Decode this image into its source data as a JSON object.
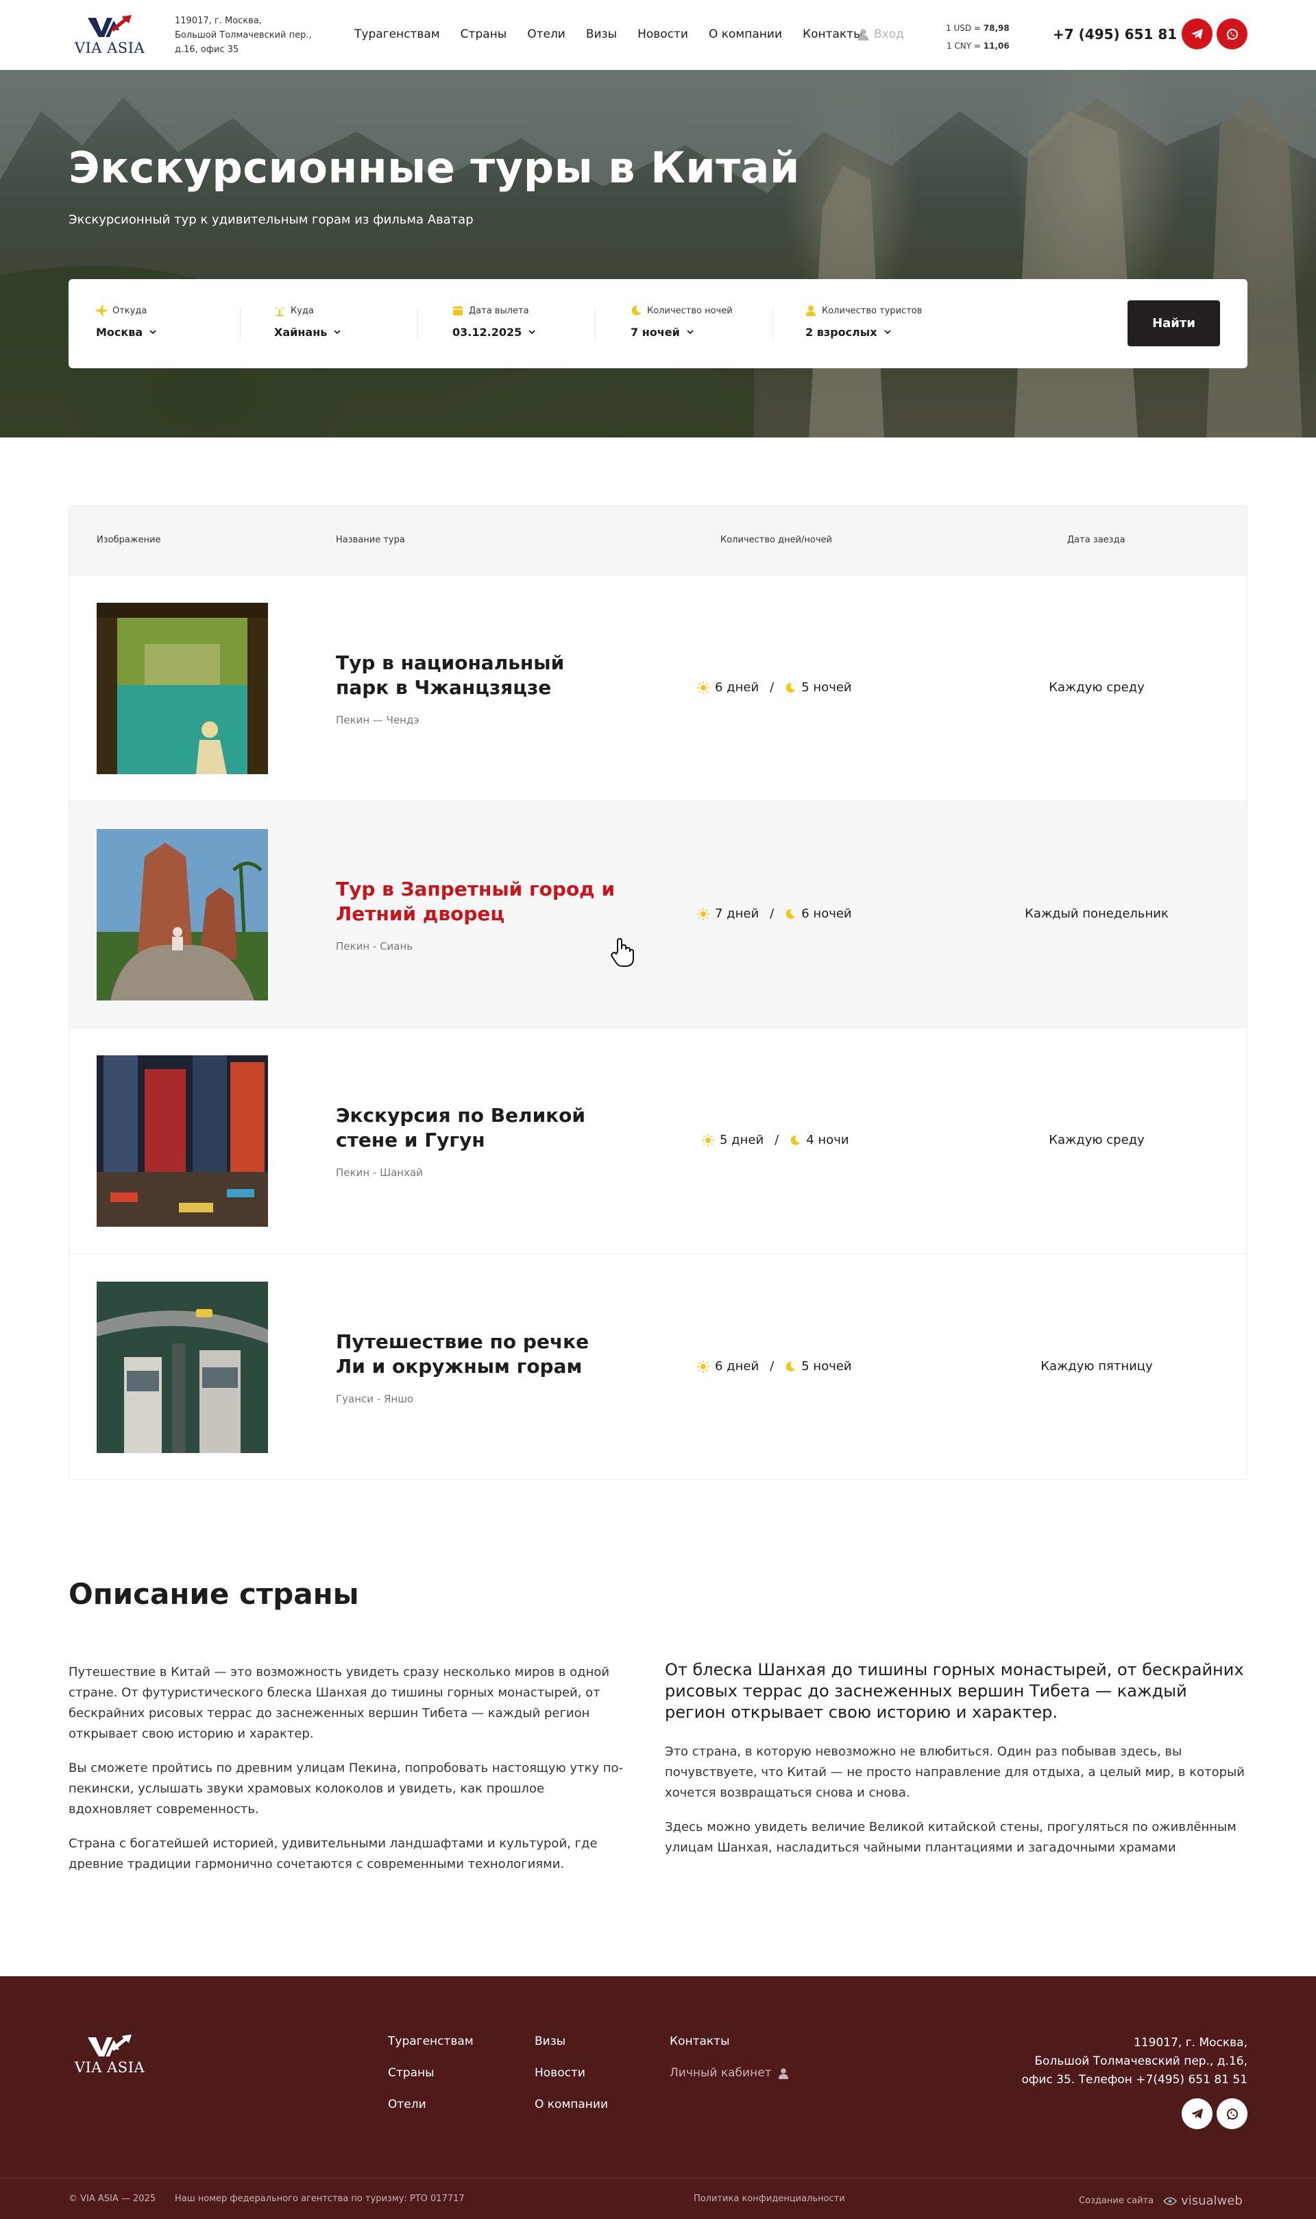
{
  "header": {
    "logo_text": "VIA ASIA",
    "address_lines": [
      "119017, г. Москва,",
      "Большой Толмачевский пер.,",
      "д.16, офис 35"
    ],
    "nav": [
      "Турагенствам",
      "Страны",
      "Отели",
      "Визы",
      "Новости",
      "О компании",
      "Контакты"
    ],
    "login_label": "Вход",
    "rates": [
      {
        "label": "1 USD =",
        "value": "78,98"
      },
      {
        "label": "1 CNY =",
        "value": "11,06"
      }
    ],
    "phone": "+7 (495) 651 81 51"
  },
  "hero": {
    "title": "Экскурсионные туры в Китай",
    "subtitle": "Экскурсионный тур к удивительным горам из фильма Аватар"
  },
  "search": {
    "fields": [
      {
        "label": "Откуда",
        "value": "Москва",
        "icon": "plane-icon"
      },
      {
        "label": "Куда",
        "value": "Хайнань",
        "icon": "palm-icon"
      },
      {
        "label": "Дата вылета",
        "value": "03.12.2025",
        "icon": "calendar-icon"
      },
      {
        "label": "Количество ночей",
        "value": "7 ночей",
        "icon": "moon-icon"
      },
      {
        "label": "Количество туристов",
        "value": "2 взрослых",
        "icon": "person-icon"
      }
    ],
    "button_label": "Найти"
  },
  "table": {
    "headers": [
      "Изображение",
      "Название тура",
      "Количество дней/ночей",
      "Дата заезда"
    ],
    "rows": [
      {
        "title": "Тур в национальный парк в Чжанцзяцзе",
        "route": "Пекин — Чендэ",
        "days": "6 дней",
        "nights": "5 ночей",
        "date": "Каждую среду",
        "highlight": false
      },
      {
        "title": "Тур в Запретный город и Летний дворец",
        "route": "Пекин - Сиань",
        "days": "7 дней",
        "nights": "6 ночей",
        "date": "Каждый понедельник",
        "highlight": true
      },
      {
        "title": "Экскурсия по Великой стене и Гугун",
        "route": "Пекин - Шанхай",
        "days": "5 дней",
        "nights": "4 ночи",
        "date": "Каждую среду",
        "highlight": false
      },
      {
        "title": "Путешествие по речке Ли и окружным горам",
        "route": "Гуанси - Яншо",
        "days": "6 дней",
        "nights": "5 ночей",
        "date": "Каждую пятницу",
        "highlight": false
      }
    ]
  },
  "description": {
    "heading": "Описание страны",
    "left": [
      "Путешествие в Китай — это возможность увидеть сразу несколько миров в одной стране. От футуристического блеска Шанхая до тишины горных монастырей, от бескрайних рисовых террас до заснеженных вершин Тибета — каждый регион открывает свою историю и характер.",
      "Вы сможете пройтись по древним улицам Пекина, попробовать настоящую утку по-пекински, услышать звуки храмовых колоколов и увидеть, как прошлое вдохновляет современность.",
      "Страна с богатейшей историей, удивительными ландшафтами и культурой, где древние традиции гармонично сочетаются с современными технологиями."
    ],
    "right_heading": "От блеска Шанхая до тишины горных монастырей, от бескрайних рисовых террас до заснеженных вершин Тибета — каждый регион открывает свою историю и характер.",
    "right": [
      "Это страна, в которую невозможно не влюбиться. Один раз побывав здесь, вы почувствуете, что Китай — не просто направление для отдыха, а целый мир, в который хочется возвращаться снова и снова.",
      "Здесь можно увидеть величие Великой китайской стены, прогуляться по оживлённым улицам Шанхая, насладиться чайными плантациями и загадочными храмами"
    ]
  },
  "footer": {
    "logo_text": "VIA ASIA",
    "col1": [
      "Турагенствам",
      "Страны",
      "Отели"
    ],
    "col2": [
      "Визы",
      "Новости",
      "О компании"
    ],
    "col3": [
      "Контакты"
    ],
    "cabinet_label": "Личный кабинет",
    "address_lines": [
      "119017, г. Москва,",
      "Большой Толмачевский пер., д.16,",
      "офис 35. Телефон +7(495) 651 81 51"
    ],
    "copyright": "© VIA ASIA — 2025",
    "registry": "Наш номер федерального агентства по туризму: РТО 017717",
    "privacy": "Политика конфиденциальности",
    "made_by_label": "Создание сайта",
    "made_by_brand": "visualweb"
  },
  "colors": {
    "accent": "#d2141a",
    "highlight_title": "#c8141a",
    "footer_bg": "#4e1a1a",
    "icon_yellow": "#f5c518",
    "button_dark": "#231f20"
  }
}
